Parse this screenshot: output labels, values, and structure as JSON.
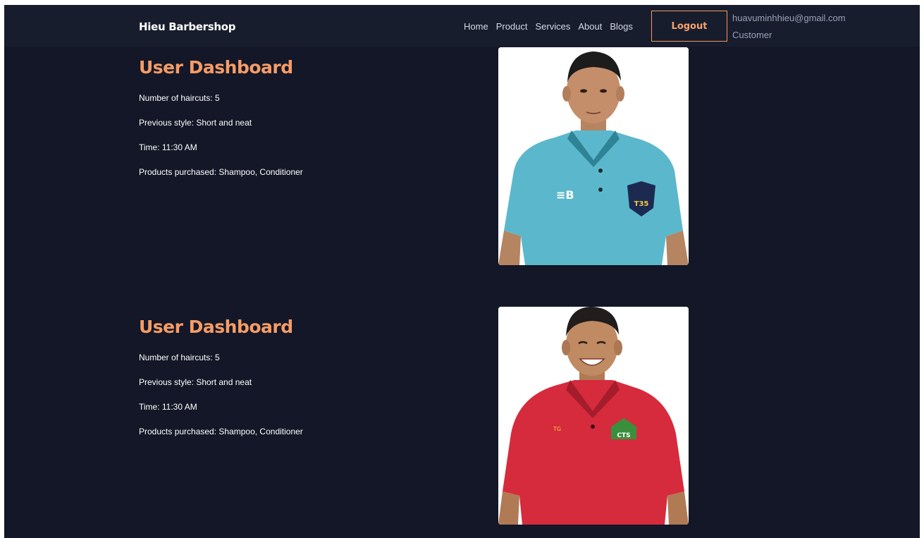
{
  "navbar": {
    "brand": "Hieu Barbershop",
    "links": [
      "Home",
      "Product",
      "Services",
      "About",
      "Blogs"
    ],
    "logout_label": "Logout",
    "user_email": "huavuminhhieu@gmail.com",
    "user_role": "Customer"
  },
  "dashboards": [
    {
      "title": "User Dashboard",
      "haircuts": "Number of haircuts: 5",
      "previous_style": "Previous style: Short and neat",
      "time": "Time: 11:30 AM",
      "products": "Products purchased: Shampoo, Conditioner",
      "photo_shirt_color": "#5bb8cc",
      "photo_badge_text": "T35"
    },
    {
      "title": "User Dashboard",
      "haircuts": "Number of haircuts: 5",
      "previous_style": "Previous style: Short and neat",
      "time": "Time: 11:30 AM",
      "products": "Products purchased: Shampoo, Conditioner",
      "photo_shirt_color": "#d62b3c",
      "photo_badge_text": "CTS"
    }
  ],
  "colors": {
    "background": "#131727",
    "navbar": "#181d2e",
    "accent": "#f59c66"
  }
}
